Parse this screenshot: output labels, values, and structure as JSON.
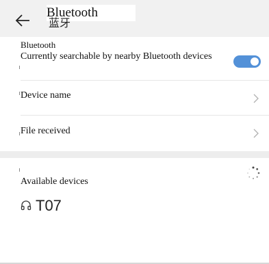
{
  "header": {
    "back_icon": "arrow-left-icon",
    "title": "Bluetooth",
    "title_overlay": "蓝牙"
  },
  "bluetooth": {
    "title": "Bluetooth",
    "subtitle": "Currently searchable by nearby Bluetooth devices",
    "enabled": true,
    "toggle_color": "#5391d8"
  },
  "device_name": {
    "label": "Device name",
    "icon": "chevron-right-icon"
  },
  "file_received": {
    "label": "File received",
    "icon": "chevron-right-icon"
  },
  "available": {
    "label": "Available devices",
    "spinner_icon": "loading-spinner-icon",
    "devices": [
      {
        "name": "T07",
        "icon": "headphones-icon"
      }
    ]
  }
}
